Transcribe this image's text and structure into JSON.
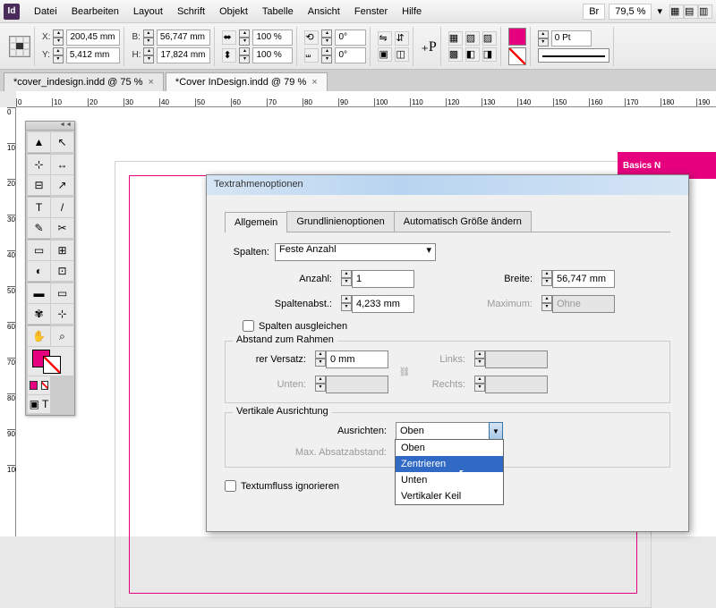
{
  "menu": {
    "items": [
      "Datei",
      "Bearbeiten",
      "Layout",
      "Schrift",
      "Objekt",
      "Tabelle",
      "Ansicht",
      "Fenster",
      "Hilfe"
    ],
    "bridge": "Br",
    "zoom": "79,5 %"
  },
  "ctrl": {
    "x": "200,45 mm",
    "y": "5,412 mm",
    "w": "56,747 mm",
    "h": "17,824 mm",
    "sx": "100 %",
    "sy": "100 %",
    "rot": "0°",
    "shear": "0°",
    "stroke": "0 Pt"
  },
  "tabs": [
    {
      "label": "*cover_indesign.indd @ 75 %",
      "active": false
    },
    {
      "label": "*Cover InDesign.indd @ 79 %",
      "active": true
    }
  ],
  "ruler": [
    "0",
    "10",
    "20",
    "30",
    "40",
    "50",
    "60",
    "70",
    "80",
    "90",
    "100",
    "110",
    "120",
    "130",
    "140",
    "150",
    "160",
    "170",
    "180",
    "190"
  ],
  "rulerV": [
    "0",
    "10",
    "20",
    "30",
    "40",
    "50",
    "60",
    "70",
    "80",
    "90",
    "100"
  ],
  "pinkbox": "Basics N",
  "tools": [
    "▲",
    "↖",
    "⊹",
    "↔",
    "⊟",
    "↗",
    "T",
    "/",
    "✎",
    "✂",
    "▭",
    "⊞",
    "◐",
    "⊡",
    "▬",
    "▭",
    "✾",
    "⊹",
    "✋",
    "⌕"
  ],
  "dialog": {
    "title": "Textrahmenoptionen",
    "tabs": [
      "Allgemein",
      "Grundlinienoptionen",
      "Automatisch Größe ändern"
    ],
    "spalten": {
      "label": "Spalten:",
      "value": "Feste Anzahl",
      "anzahl_l": "Anzahl:",
      "anzahl": "1",
      "breite_l": "Breite:",
      "breite": "56,747 mm",
      "abst_l": "Spaltenabst.:",
      "abst": "4,233 mm",
      "max_l": "Maximum:",
      "max": "Ohne",
      "ausgl": "Spalten ausgleichen"
    },
    "abstand": {
      "legend": "Abstand zum Rahmen",
      "versatz_l": "rer Versatz:",
      "versatz": "0 mm",
      "unten_l": "Unten:",
      "links_l": "Links:",
      "rechts_l": "Rechts:"
    },
    "vert": {
      "legend": "Vertikale Ausrichtung",
      "ausr_l": "Ausrichten:",
      "ausr": "Oben",
      "maxabs_l": "Max. Absatzabstand:",
      "options": [
        "Oben",
        "Zentrieren",
        "Unten",
        "Vertikaler Keil"
      ]
    },
    "textfluss": "Textumfluss ignorieren"
  }
}
